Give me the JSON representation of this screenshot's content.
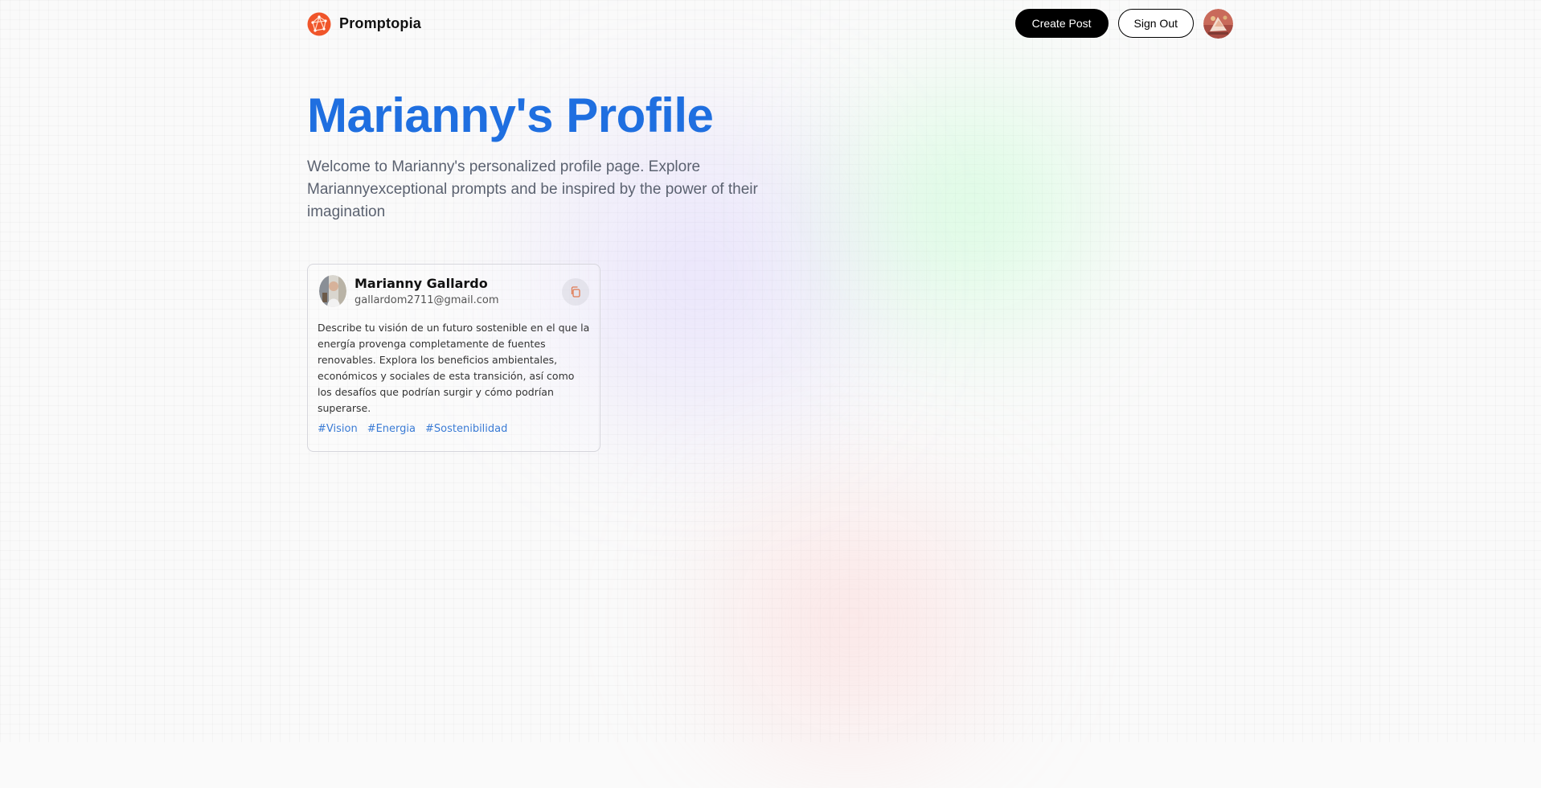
{
  "nav": {
    "brand": "Promptopia",
    "create_post": "Create Post",
    "sign_out": "Sign Out"
  },
  "profile": {
    "title": "Marianny's Profile",
    "description": "Welcome to Marianny's personalized profile page. Explore Mariannyexceptional prompts and be inspired by the power of their imagination"
  },
  "posts": [
    {
      "author_name": "Marianny Gallardo",
      "author_email": "gallardom2711@gmail.com",
      "prompt": "Describe tu visión de un futuro sostenible en el que la energía provenga completamente de fuentes renovables. Explora los beneficios ambientales, económicos y sociales de esta transición, así como los desafíos que podrían surgir y cómo podrían superarse.",
      "tags": [
        "#Vision",
        "#Energia",
        "#Sostenibilidad"
      ]
    }
  ],
  "colors": {
    "title_blue": "#1f6fe0",
    "tag_blue": "#3a7bd5",
    "logo_orange": "#f0552a"
  },
  "icons": {
    "logo": "promptopia-logo-icon",
    "copy": "copy-icon"
  }
}
